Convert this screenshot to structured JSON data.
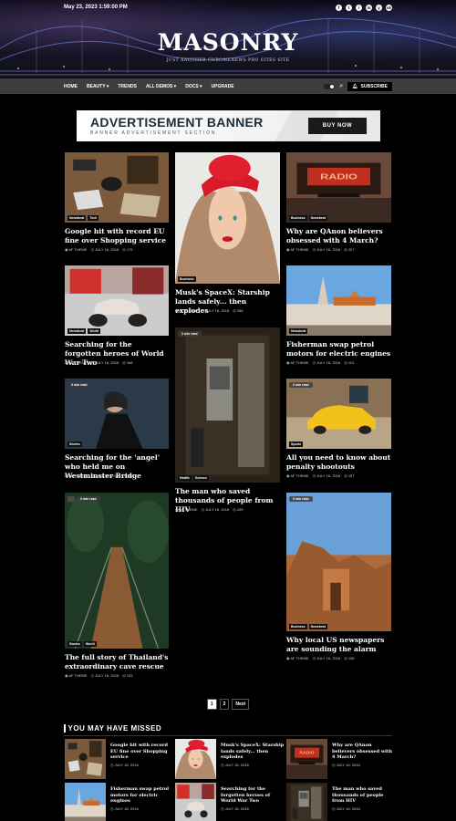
{
  "topbar": {
    "date": "May 23, 2023 1:59:00 PM",
    "social": [
      "f",
      "t",
      "i",
      "in",
      "y",
      "vk"
    ]
  },
  "site": {
    "title": "MASONRY",
    "tagline": "JUST ANOTHER CHROMENEWS PRO SITES SITE"
  },
  "nav": {
    "items": [
      "HOME",
      "BEAUTY ▾",
      "TRENDS",
      "ALL DEMOS ▾",
      "DOCS ▾",
      "UPGRADE"
    ],
    "subscribe": "SUBSCRIBE"
  },
  "ad": {
    "title": "ADVERTISEMENT BANNER",
    "subtitle": "BANNER ADVERTISEMENT SECTION",
    "button": "BUY NOW"
  },
  "meta": {
    "author": "AF THEME",
    "date": "JULY 18, 2018",
    "readtime": "3 min read"
  },
  "posts": [
    {
      "title": "Google hit with record EU fine over Shopping service",
      "tags": [
        "Newsbeat",
        "Tech"
      ],
      "views": "175",
      "image": "desk"
    },
    {
      "title": "Musk's SpaceX: Starship lands safely... then explodes",
      "tags": [
        "Business"
      ],
      "views": "268",
      "image": "woman-red-hat"
    },
    {
      "title": "Why are QAnon believers obsessed with 4 March?",
      "tags": [
        "Business",
        "Newsbeat"
      ],
      "views": "207",
      "image": "radio-city"
    },
    {
      "title": "Searching for the forgotten heroes of World War Two",
      "tags": [
        "Newsbeat",
        "World"
      ],
      "views": "168",
      "image": "vespa"
    },
    {
      "title": "Fisherman swap petrol motors for electric engines",
      "tags": [
        "Newsbeat"
      ],
      "views": "113",
      "image": "cathedral"
    },
    {
      "title": "Searching for the 'angel' who held me on Westminster Bridge",
      "tags": [
        "Stories"
      ],
      "views": "136",
      "image": "woman-dark"
    },
    {
      "title": "The man who saved thousands of people from HIV",
      "tags": [
        "Health",
        "Science"
      ],
      "views": "209",
      "image": "phone"
    },
    {
      "title": "All you need to know about penalty shootouts",
      "tags": [
        "Sports"
      ],
      "views": "157",
      "image": "yellow-car"
    },
    {
      "title": "The full story of Thailand's extraordinary cave rescue",
      "tags": [
        "Stories",
        "World"
      ],
      "views": "133",
      "image": "bridge"
    },
    {
      "title": "Why local US newspapers are sounding the alarm",
      "tags": [
        "Business",
        "Newsbeat"
      ],
      "views": "138",
      "image": "petra"
    }
  ],
  "pagination": [
    "1",
    "2",
    "Next"
  ],
  "missed": {
    "heading": "YOU MAY HAVE MISSED",
    "items": [
      {
        "title": "Google hit with record EU fine over Shopping service",
        "date": "JULY 18, 2018"
      },
      {
        "title": "Musk's SpaceX: Starship lands safely... then explodes",
        "date": "JULY 18, 2018"
      },
      {
        "title": "Why are QAnon believers obsessed with 4 March?",
        "date": "JULY 18, 2018"
      },
      {
        "title": "Fisherman swap petrol motors for electric engines",
        "date": "JULY 18, 2018"
      },
      {
        "title": "Searching for the forgotten heroes of World War Two",
        "date": "JULY 18, 2018"
      },
      {
        "title": "The man who saved thousands of people from HIV",
        "date": "JULY 18, 2018"
      }
    ]
  }
}
